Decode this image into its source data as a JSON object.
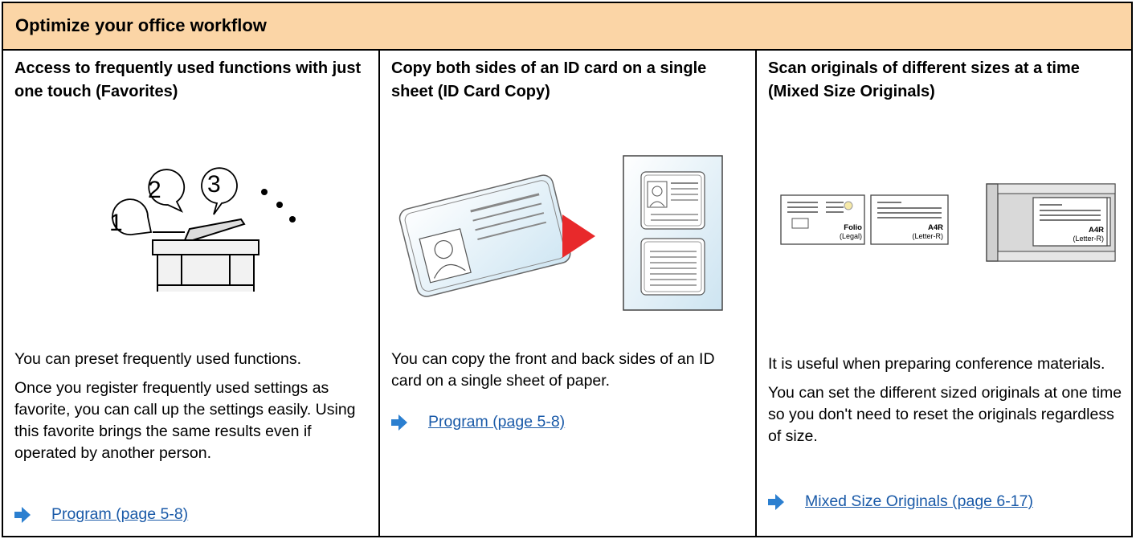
{
  "header": {
    "title": "Optimize your office workflow"
  },
  "columns": [
    {
      "title": "Access to frequently used functions with just one touch (Favorites)",
      "illustration": {
        "numbers": [
          "1",
          "2",
          "3"
        ]
      },
      "paragraphs": [
        "You can preset frequently used functions.",
        "Once you register frequently used settings as favorite, you can call up the settings easily. Using this favorite brings the same results even if operated by another person."
      ],
      "link": "Program (page 5-8)"
    },
    {
      "title": "Copy both sides of an ID card on a single sheet (ID Card Copy)",
      "paragraphs": [
        "You can copy the front and back sides of an ID card on a single sheet of paper."
      ],
      "link": "Program (page 5-8)"
    },
    {
      "title": "Scan originals of different sizes at a time (Mixed Size Originals)",
      "illustration": {
        "sheet1_size": "Folio",
        "sheet1_size_alt": "(Legal)",
        "sheet2_size": "A4R",
        "sheet2_size_alt": "(Letter-R)",
        "tray_size": "A4R",
        "tray_size_alt": "(Letter-R)"
      },
      "paragraphs": [
        "It is useful when preparing conference materials.",
        "You can set the different sized originals at one time so you don't need to reset the originals regardless of size."
      ],
      "link": "Mixed Size Originals (page 6-17)"
    }
  ],
  "colors": {
    "header_bg": "#fbd5a6",
    "link": "#1a5aa8",
    "arrow": "#2b7fd0",
    "play": "#e8292b"
  }
}
